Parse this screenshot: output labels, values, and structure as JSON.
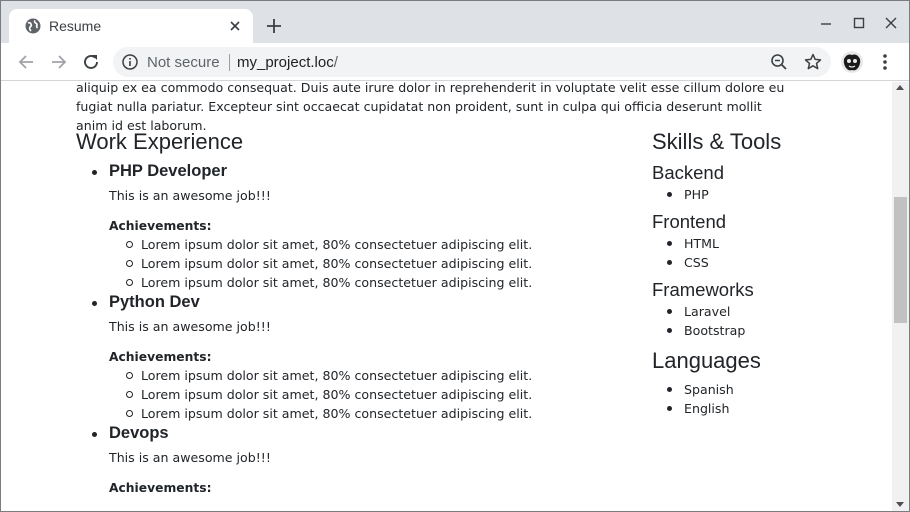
{
  "browser": {
    "tab_title": "Resume",
    "security_label": "Not secure",
    "url_host": "my_project.loc",
    "url_path": "/"
  },
  "page": {
    "intro_text": "aliquip ex ea commodo consequat. Duis aute irure dolor in reprehenderit in voluptate velit esse cillum dolore eu fugiat nulla pariatur. Excepteur sint occaecat cupidatat non proident, sunt in culpa qui officia deserunt mollit anim id est laborum.",
    "work": {
      "title": "Work Experience",
      "jobs": [
        {
          "role": "PHP Developer",
          "description": "This is an awesome job!!!",
          "achievements_label": "Achievements:",
          "achievements": [
            "Lorem ipsum dolor sit amet, 80% consectetuer adipiscing elit.",
            "Lorem ipsum dolor sit amet, 80% consectetuer adipiscing elit.",
            "Lorem ipsum dolor sit amet, 80% consectetuer adipiscing elit."
          ]
        },
        {
          "role": "Python Dev",
          "description": "This is an awesome job!!!",
          "achievements_label": "Achievements:",
          "achievements": [
            "Lorem ipsum dolor sit amet, 80% consectetuer adipiscing elit.",
            "Lorem ipsum dolor sit amet, 80% consectetuer adipiscing elit.",
            "Lorem ipsum dolor sit amet, 80% consectetuer adipiscing elit."
          ]
        },
        {
          "role": "Devops",
          "description": "This is an awesome job!!!",
          "achievements_label": "Achievements:"
        }
      ]
    },
    "skills": {
      "title": "Skills & Tools",
      "groups": [
        {
          "name": "Backend",
          "items": [
            "PHP"
          ]
        },
        {
          "name": "Frontend",
          "items": [
            "HTML",
            "CSS"
          ]
        },
        {
          "name": "Frameworks",
          "items": [
            "Laravel",
            "Bootstrap"
          ]
        }
      ]
    },
    "languages": {
      "title": "Languages",
      "items": [
        "Spanish",
        "English"
      ]
    }
  },
  "icons": {
    "favicon": "globe-icon",
    "tab_close": "close-icon",
    "new_tab": "plus-icon",
    "back": "arrow-left-icon",
    "forward": "arrow-right-icon",
    "reload": "reload-icon",
    "info": "info-icon",
    "zoom": "zoom-out-icon",
    "bookmark": "star-icon",
    "menu": "kebab-menu-icon"
  }
}
